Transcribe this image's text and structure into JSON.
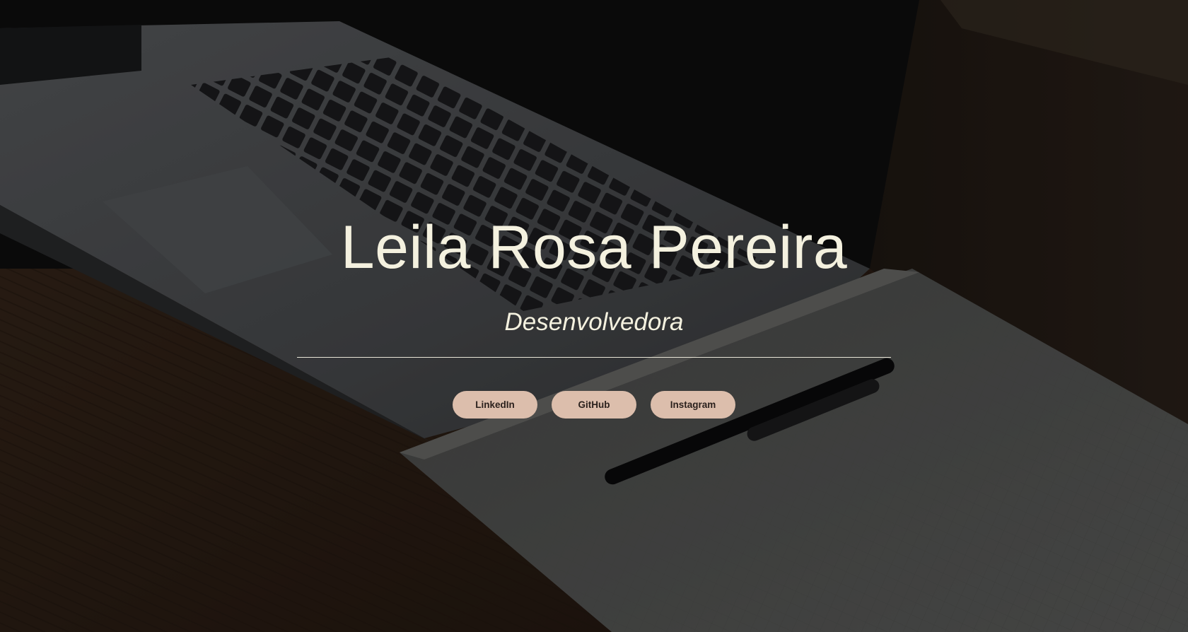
{
  "hero": {
    "name": "Leila Rosa Pereira",
    "role": "Desenvolvedora"
  },
  "social_links": [
    {
      "label": "LinkedIn"
    },
    {
      "label": "GitHub"
    },
    {
      "label": "Instagram"
    }
  ],
  "colors": {
    "title_text": "#f4f1df",
    "button_bg": "#dcbeac",
    "button_text": "#2b211d",
    "divider": "#e9e6d8"
  },
  "background_image": "laptop-notebook-pen-on-wooden-desk-dimmed"
}
